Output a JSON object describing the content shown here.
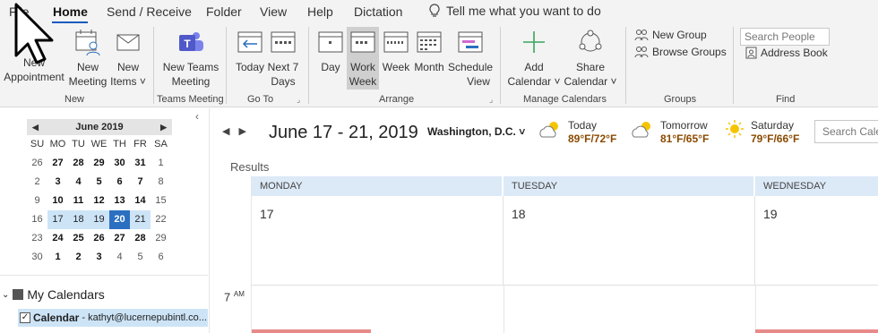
{
  "menu": {
    "tabs": [
      "File",
      "Home",
      "Send / Receive",
      "Folder",
      "View",
      "Help",
      "Dictation"
    ],
    "active": "Home",
    "tell_me": "Tell me what you want to do"
  },
  "ribbon": {
    "new_group": {
      "new_appointment": [
        "New",
        "Appointment"
      ],
      "new_meeting": [
        "New",
        "Meeting"
      ],
      "new_items": [
        "New",
        "Items ˅"
      ],
      "label": "New"
    },
    "teams_group": {
      "new_teams_meeting": [
        "New Teams",
        "Meeting"
      ],
      "label": "Teams Meeting"
    },
    "goto_group": {
      "today": "Today",
      "next7": [
        "Next 7",
        "Days"
      ],
      "label": "Go To"
    },
    "arrange_group": {
      "day": "Day",
      "work_week": [
        "Work",
        "Week"
      ],
      "week": "Week",
      "month": "Month",
      "schedule_view": [
        "Schedule",
        "View"
      ],
      "label": "Arrange"
    },
    "manage_group": {
      "add_calendar": [
        "Add",
        "Calendar ˅"
      ],
      "share_calendar": [
        "Share",
        "Calendar ˅"
      ],
      "label": "Manage Calendars"
    },
    "groups_group": {
      "new_group": "New Group",
      "browse_groups": "Browse Groups",
      "label": "Groups"
    },
    "find_group": {
      "search_people_placeholder": "Search People",
      "address_book": "Address Book",
      "label": "Find"
    }
  },
  "mini_calendar": {
    "month_label": "June 2019",
    "day_headers": [
      "SU",
      "MO",
      "TU",
      "WE",
      "TH",
      "FR",
      "SA"
    ],
    "weeks": [
      [
        "26",
        "27",
        "28",
        "29",
        "30",
        "31",
        "1"
      ],
      [
        "2",
        "3",
        "4",
        "5",
        "6",
        "7",
        "8"
      ],
      [
        "9",
        "10",
        "11",
        "12",
        "13",
        "14",
        "15"
      ],
      [
        "16",
        "17",
        "18",
        "19",
        "20",
        "21",
        "22"
      ],
      [
        "23",
        "24",
        "25",
        "26",
        "27",
        "28",
        "29"
      ],
      [
        "30",
        "1",
        "2",
        "3",
        "4",
        "5",
        "6"
      ]
    ]
  },
  "folders": {
    "my_calendars": "My Calendars",
    "calendar_name": "Calendar",
    "calendar_account": " - kathyt@lucernepubintl.co..."
  },
  "main": {
    "date_range": "June 17 - 21, 2019",
    "location": "Washington,  D.C. ˅",
    "weather": [
      {
        "label": "Today",
        "temp": "89°F/72°F",
        "icon": "partly-cloudy-icon"
      },
      {
        "label": "Tomorrow",
        "temp": "81°F/65°F",
        "icon": "partly-cloudy-icon"
      },
      {
        "label": "Saturday",
        "temp": "79°F/66°F",
        "icon": "sunny-icon"
      }
    ],
    "search_placeholder": "Search Calendar",
    "results_label": "Results",
    "days": [
      {
        "name": "MONDAY",
        "num": "17"
      },
      {
        "name": "TUESDAY",
        "num": "18"
      },
      {
        "name": "WEDNESDAY",
        "num": "19"
      }
    ],
    "time_label": "7",
    "time_suffix": "AM"
  },
  "colors": {
    "accent": "#185abd",
    "selected_week": "#cde4f7",
    "today": "#2b6fc0",
    "day_header": "#dce9f7"
  }
}
